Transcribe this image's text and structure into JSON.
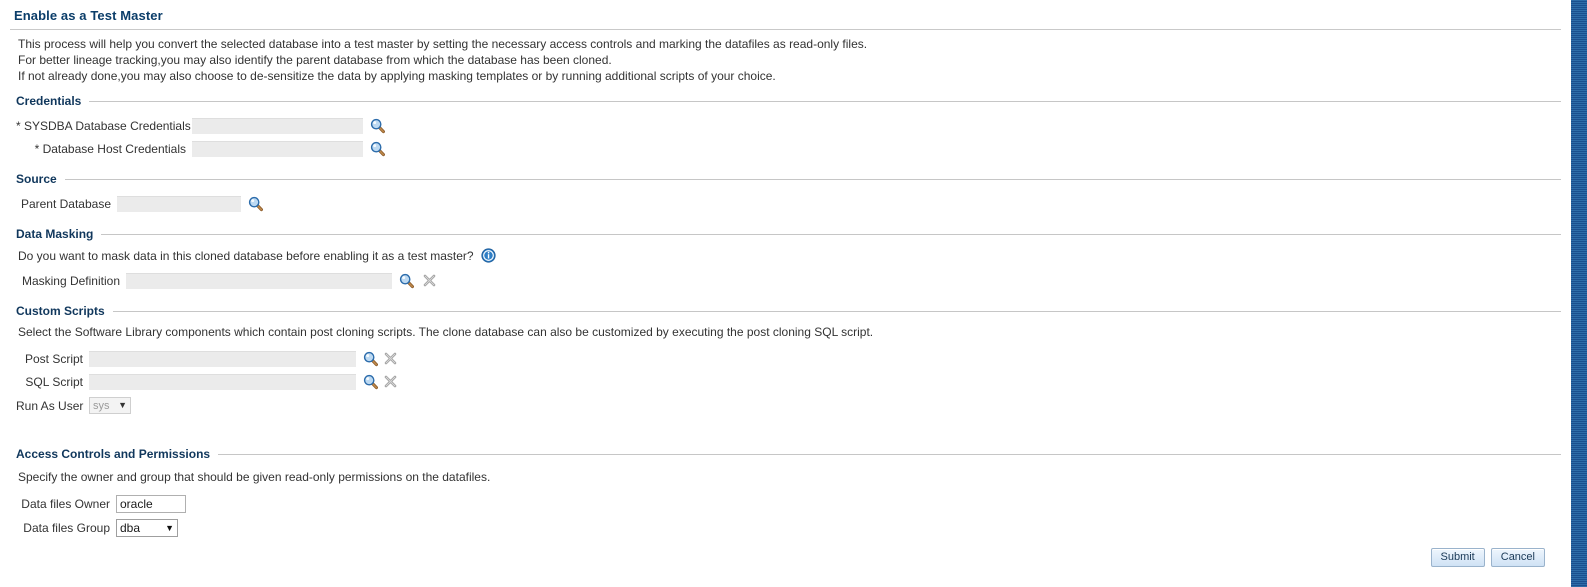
{
  "page": {
    "title": "Enable as a Test Master",
    "intro_lines": [
      "This process will help you convert the selected database into a test master by setting the necessary access controls and marking the datafiles as read-only files.",
      "For better lineage tracking,you may also identify the parent database from which the database has been cloned.",
      "If not already done,you may also choose to de-sensitize the data by applying masking templates or by running additional scripts of your choice."
    ]
  },
  "credentials": {
    "section_title": "Credentials",
    "sysdba": {
      "label": "* SYSDBA Database Credentials",
      "value": "",
      "search_icon": "magnifier-icon"
    },
    "host": {
      "label": "* Database Host Credentials",
      "value": "",
      "search_icon": "magnifier-icon"
    }
  },
  "source": {
    "section_title": "Source",
    "parent_database": {
      "label": "Parent Database",
      "value": "",
      "search_icon": "magnifier-icon"
    }
  },
  "data_masking": {
    "section_title": "Data Masking",
    "question": "Do you want to mask data in this cloned database before enabling it as a test master?",
    "info_icon": "info-icon",
    "masking_definition": {
      "label": "Masking Definition",
      "value": "",
      "search_icon": "magnifier-icon",
      "clear_icon": "clear-x-icon"
    }
  },
  "custom_scripts": {
    "section_title": "Custom Scripts",
    "description": "Select the Software Library components which contain post cloning scripts. The clone database can also be customized by executing the post cloning SQL script.",
    "post_script": {
      "label": "Post Script",
      "value": "",
      "search_icon": "magnifier-icon",
      "clear_icon": "clear-x-icon"
    },
    "sql_script": {
      "label": "SQL Script",
      "value": "",
      "search_icon": "magnifier-icon",
      "clear_icon": "clear-x-icon"
    },
    "run_as_user": {
      "label": "Run As User",
      "value": "sys",
      "options": [
        "sys"
      ]
    }
  },
  "access_controls": {
    "section_title": "Access Controls and Permissions",
    "description": "Specify the owner and group that should be given read-only permissions on the datafiles.",
    "data_files_owner": {
      "label": "Data files Owner",
      "value": "oracle"
    },
    "data_files_group": {
      "label": "Data files Group",
      "value": "dba",
      "options": [
        "dba"
      ]
    }
  },
  "actions": {
    "submit_label": "Submit",
    "cancel_label": "Cancel"
  },
  "colors": {
    "title_blue": "#0b3d69",
    "section_blue": "#10375c",
    "accent_band": "#1e5799",
    "field_disabled": "#ebebeb"
  }
}
